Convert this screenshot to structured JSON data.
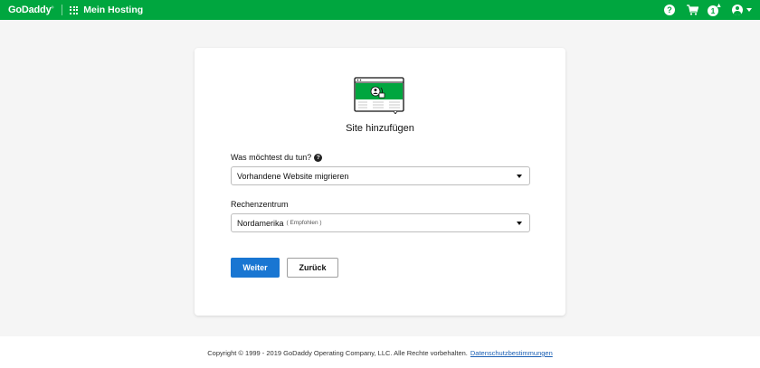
{
  "header": {
    "logo": "GoDaddy",
    "app_title": "Mein Hosting",
    "help_icon": "?",
    "notification_count": "1",
    "brand_color": "#00a63f",
    "icons": [
      "apps-grid-icon",
      "help-icon",
      "cart-icon",
      "bell-icon",
      "user-icon",
      "chevron-down-icon"
    ]
  },
  "card": {
    "title": "Site hinzufügen",
    "illustration_icon": "website-migration-illustration",
    "fields": [
      {
        "label": "Was möchtest du tun?",
        "info_icon": "?",
        "value": "Vorhandene Website migrieren",
        "hint": ""
      },
      {
        "label": "Rechenzentrum",
        "value": "Nordamerika",
        "hint": "( Empfohlen )"
      }
    ],
    "primary_button": "Weiter",
    "primary_color": "#1976d2",
    "secondary_button": "Zurück"
  },
  "footer": {
    "copyright": "Copyright © 1999 - 2019 GoDaddy Operating Company, LLC. Alle Rechte vorbehalten.",
    "privacy_link": "Datenschutzbestimmungen"
  }
}
